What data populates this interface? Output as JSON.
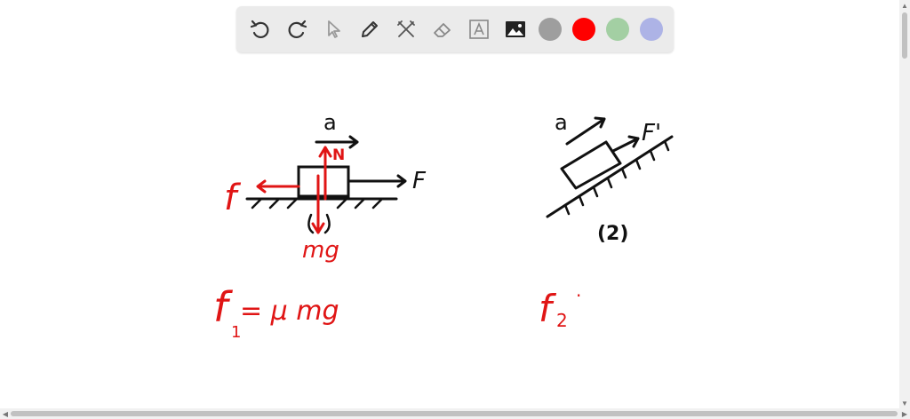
{
  "toolbar": {
    "tools": [
      "undo-icon",
      "redo-icon",
      "pointer-icon",
      "pen-icon",
      "tools-icon",
      "eraser-icon",
      "text-icon",
      "image-icon"
    ],
    "colors": [
      "#9e9e9e",
      "#ff0000",
      "#a3cfa3",
      "#adb3e6"
    ]
  },
  "drawing": {
    "left": {
      "accel_label": "a",
      "normal_label": "N",
      "force_label": "F",
      "friction_label": "f",
      "weight_label": "mg",
      "equation": "f",
      "equation_sub": "1",
      "equation_rhs": "= μ mg"
    },
    "right": {
      "accel_label": "a",
      "force_label": "F'",
      "caption": "(2)",
      "equation": "f",
      "equation_sub": "2",
      "equation_tail": "·"
    }
  }
}
